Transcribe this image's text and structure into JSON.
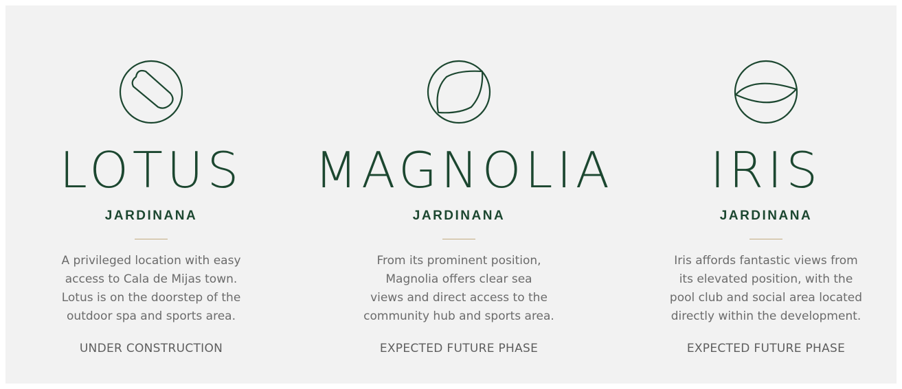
{
  "colors": {
    "background": "#f2f2f2",
    "brand_green": "#1c4730",
    "accent_gold": "#c2ab80",
    "body_text": "#6b6b6b"
  },
  "phases": [
    {
      "icon": "lotus-leaf-icon",
      "name": "LOTUS",
      "subtitle": "JARDINANA",
      "description_lines": [
        "A privileged location with easy",
        "access to Cala de Mijas town.",
        "Lotus is on the doorstep of the",
        "outdoor spa and sports area."
      ],
      "status": "UNDER CONSTRUCTION"
    },
    {
      "icon": "magnolia-leaf-icon",
      "name": "MAGNOLIA",
      "subtitle": "JARDINANA",
      "description_lines": [
        "From its prominent position,",
        "Magnolia offers clear sea",
        "views and direct access to the",
        "community hub and sports area."
      ],
      "status": "EXPECTED FUTURE PHASE"
    },
    {
      "icon": "iris-leaf-icon",
      "name": "IRIS",
      "subtitle": "JARDINANA",
      "description_lines": [
        "Iris affords fantastic views from",
        "its elevated position, with the",
        "pool club and social area located",
        "directly within the development."
      ],
      "status": "EXPECTED FUTURE PHASE"
    }
  ]
}
